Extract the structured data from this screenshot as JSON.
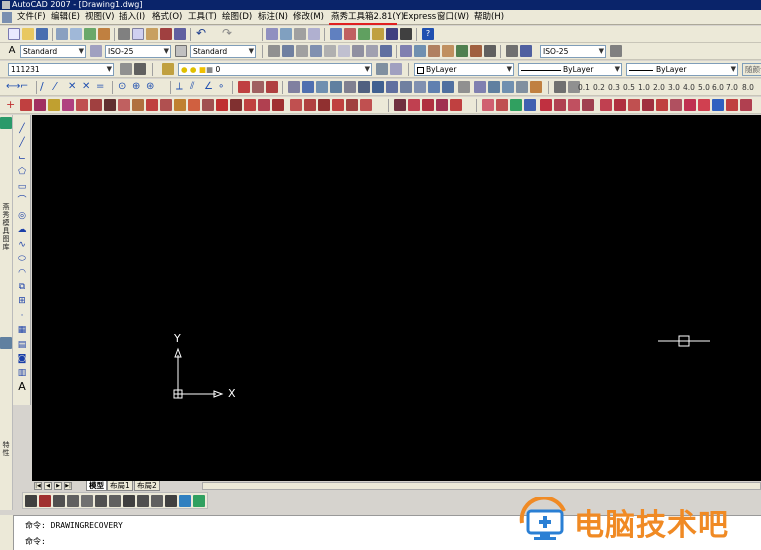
{
  "window": {
    "title": "AutoCAD 2007 - [Drawing1.dwg]"
  },
  "menu": {
    "items": [
      {
        "label": "文件(F)"
      },
      {
        "label": "编辑(E)"
      },
      {
        "label": "视图(V)"
      },
      {
        "label": "插入(I)"
      },
      {
        "label": "格式(O)"
      },
      {
        "label": "工具(T)"
      },
      {
        "label": "绘图(D)"
      },
      {
        "label": "标注(N)"
      },
      {
        "label": "修改(M)"
      },
      {
        "label": "燕秀工具箱2.81(Y)"
      },
      {
        "label": "Express"
      },
      {
        "label": "窗口(W)"
      },
      {
        "label": "帮助(H)"
      }
    ],
    "highlight_color": "#e02020"
  },
  "styles_toolbar": {
    "text_style": "Standard",
    "dim_style": "ISO-25",
    "table_style": "Standard",
    "mleader_style": "ISO-25"
  },
  "layers_toolbar": {
    "layer_name": "111231",
    "current_layer": "0",
    "color": "ByLayer",
    "linetype": "ByLayer",
    "lineweight": "ByLayer",
    "plot_style": "随颜色"
  },
  "lineweight_bar": {
    "values": [
      "0.1",
      "0.2",
      "0.3",
      "0.5",
      "1.0",
      "2.0",
      "3.0",
      "4.0",
      "5.0",
      "6.0",
      "7.0",
      "8.0"
    ]
  },
  "left_panel": {
    "label_top": "燕秀模具图库",
    "label_bottom": "特性"
  },
  "canvas": {
    "background": "#000000",
    "ucs": {
      "x_label": "X",
      "y_label": "Y"
    }
  },
  "layout_tabs": {
    "tabs": [
      {
        "label": "模型",
        "active": true
      },
      {
        "label": "布局1",
        "active": false
      },
      {
        "label": "布局2",
        "active": false
      }
    ]
  },
  "command": {
    "lines": [
      "命令: DRAWINGRECOVERY",
      "命令:"
    ]
  },
  "watermark": {
    "text": "电脑技术吧",
    "color": "#f08a24"
  }
}
